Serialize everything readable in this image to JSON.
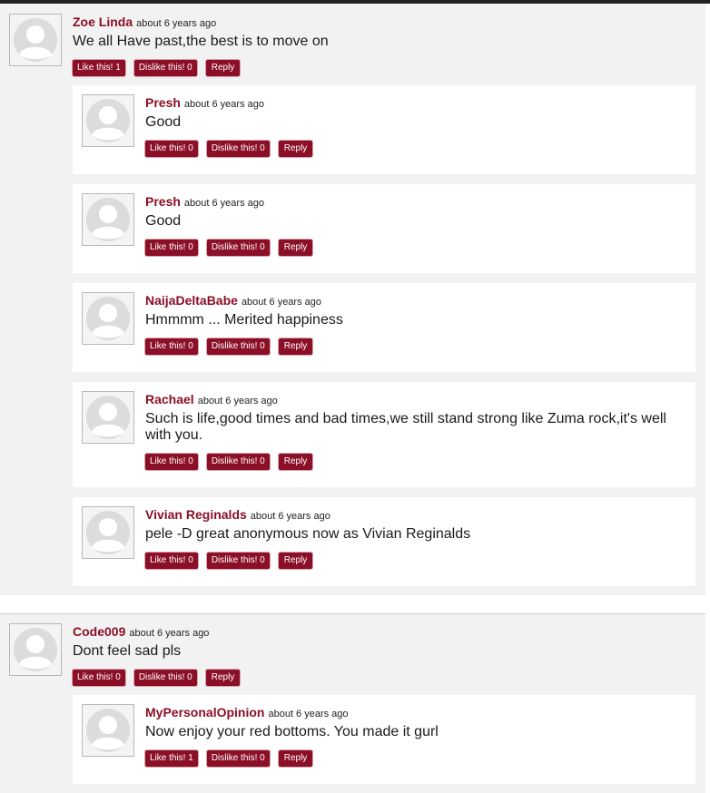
{
  "threads": [
    {
      "comment": {
        "author": "Zoe Linda",
        "time": "about 6 years ago",
        "text": "We all Have past,the best is to move on",
        "like_label": "Like this! 1",
        "dislike_label": "Dislike this! 0",
        "reply_label": "Reply"
      },
      "replies": [
        {
          "author": "Presh",
          "time": "about 6 years ago",
          "text": "Good",
          "like_label": "Like this! 0",
          "dislike_label": "Dislike this! 0",
          "reply_label": "Reply"
        },
        {
          "author": "Presh",
          "time": "about 6 years ago",
          "text": "Good",
          "like_label": "Like this! 0",
          "dislike_label": "Dislike this! 0",
          "reply_label": "Reply"
        },
        {
          "author": "NaijaDeltaBabe",
          "time": "about 6 years ago",
          "text": "Hmmmm ... Merited happiness",
          "like_label": "Like this! 0",
          "dislike_label": "Dislike this! 0",
          "reply_label": "Reply"
        },
        {
          "author": "Rachael",
          "time": "about 6 years ago",
          "text": "Such is life,good times and bad times,we still stand strong like Zuma rock,it's well with you.",
          "like_label": "Like this! 0",
          "dislike_label": "Dislike this! 0",
          "reply_label": "Reply"
        },
        {
          "author": "Vivian Reginalds",
          "time": "about 6 years ago",
          "text": "pele -D great anonymous now as Vivian Reginalds",
          "like_label": "Like this! 0",
          "dislike_label": "Dislike this! 0",
          "reply_label": "Reply"
        }
      ]
    },
    {
      "comment": {
        "author": "Code009",
        "time": "about 6 years ago",
        "text": "Dont feel sad pls",
        "like_label": "Like this! 0",
        "dislike_label": "Dislike this! 0",
        "reply_label": "Reply"
      },
      "replies": [
        {
          "author": "MyPersonalOpinion",
          "time": "about 6 years ago",
          "text": "Now enjoy your red bottoms. You made it gurl",
          "like_label": "Like this! 1",
          "dislike_label": "Dislike this! 0",
          "reply_label": "Reply"
        }
      ]
    }
  ],
  "colors": {
    "accent": "#8b0f26",
    "thread_bg": "#f2f2f2",
    "reply_bg": "#ffffff"
  },
  "icons": {
    "avatar": "user-avatar-icon"
  }
}
